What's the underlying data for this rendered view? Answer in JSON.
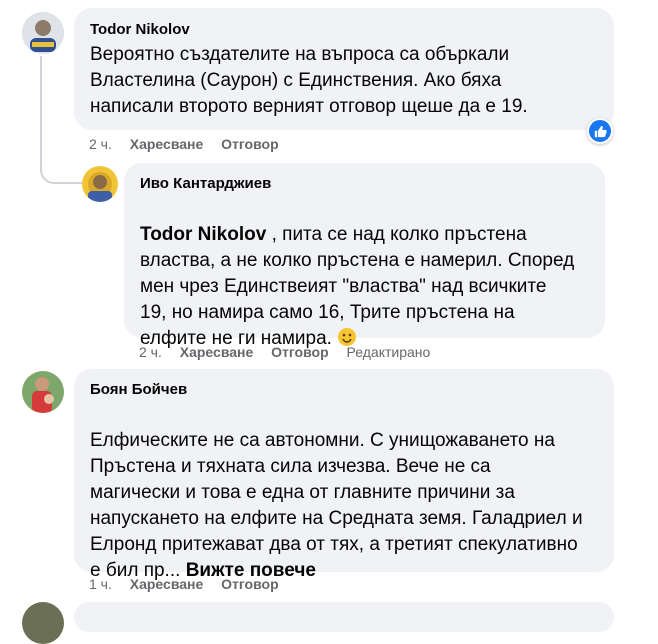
{
  "comments": [
    {
      "author": "Todor Nikolov",
      "text": "Вероятно създателите на въпроса са объркали\nВластелина (Саурон) с Единствения. Ако бяха\nнаписали второто верният отговор щеше да е 19.",
      "time": "2 ч.",
      "like_label": "Харесване",
      "reply_label": "Отговор",
      "reaction_icon": "like-icon"
    },
    {
      "author": "Иво Кантарджиев",
      "mention": "Todor Nikolov",
      "text_line1_rest": " , пита се над колко пръстена",
      "text_rest": "властва, а не колко пръстена е намерил. Според\nмен чрез Единствеият \"властва\" над всичките\n19, но намира само 16, Трите пръстена на\nелфите не ги намира.",
      "emoji": "🙂",
      "time": "2 ч.",
      "like_label": "Харесване",
      "reply_label": "Отговор",
      "edited_label": "Редактирано"
    },
    {
      "author": "Боян Бойчев",
      "text": "Елфическите не са автономни. С унищожаването на\nПръстена и тяхната сила изчезва. Вече не са\nмагически и това е една от главните причини за\nнапускането на елфите на Средната земя. Галадриел и\nЕлронд притежават два от тях, а третият спекулативно\nе бил пр... ",
      "see_more_label": "Вижте повече",
      "time": "1 ч.",
      "like_label": "Харесване",
      "reply_label": "Отговор"
    }
  ]
}
